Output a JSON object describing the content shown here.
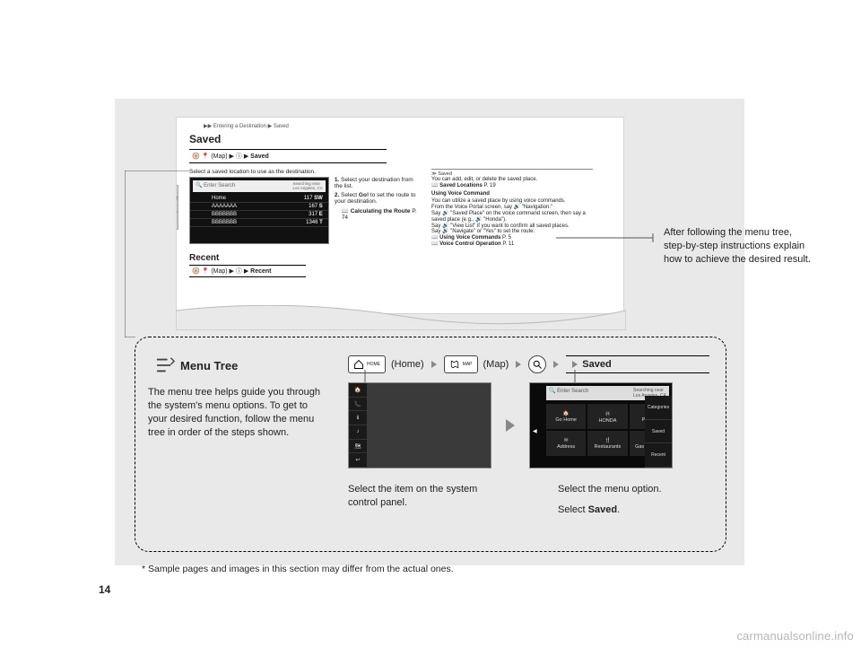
{
  "page_number": "14",
  "watermark": "carmanualsonline.info",
  "callout_text": "After following the menu tree, step-by-step instructions explain how to achieve the desired result.",
  "sample": {
    "breadcrumb_top": "▶▶ Entering a Destination ▶ Saved",
    "heading": "Saved",
    "breadcrumb2_prefix": "(Map) ▶ ⓘ ▶ ",
    "breadcrumb2_bold": "Saved",
    "instruction": "Select a saved location to use as the destination.",
    "search_placeholder": "Enter Search",
    "search_hint": "Searching near\nLos Angeles, CA",
    "rows": [
      {
        "name": "Home",
        "dist": "117",
        "dir": "SW"
      },
      {
        "name": "AAAAAAA",
        "dist": "167",
        "dir": "S"
      },
      {
        "name": "BBBBBBB",
        "dist": "317",
        "dir": "E"
      },
      {
        "name": "BBBBBBB",
        "dist": "1346",
        "dir": "T"
      }
    ],
    "step1_a": "1. ",
    "step1_b": "Select your destination from the list.",
    "step2_a": "2. ",
    "step2_b": "Select ",
    "step2_c": "Go!",
    "step2_d": " to set the route to your destination.",
    "step2_ref_label": "Calculating the Route",
    "step2_ref_page": " P. 74",
    "recent_heading": "Recent",
    "breadcrumb3_prefix": "(Map) ▶ ⓘ ▶ ",
    "breadcrumb3_bold": "Recent",
    "info": {
      "h1": "Saved",
      "l1": "You can add, edit, or delete the saved place.",
      "l1_ref": "Saved Locations",
      "l1_pg": " P. 19",
      "h2": "Using Voice Command",
      "l2a": "You can utilize a saved place by using voice commands.",
      "l2b": "From the Voice Portal screen, say 🔊 \"Navigation.\"",
      "l2c": "Say 🔊 \"Saved Place\" on the voice command screen, then say a saved place (e.g., 🔊 \"Honda\").",
      "l2d": "Say 🔊 \"View List\" if you want to confirm all saved places.",
      "l2e": "Say 🔊 \"Navigate\" or \"Yes\" to set the route.",
      "ref2": "Using Voice Commands",
      "ref2pg": " P. 5",
      "ref3": "Voice Control Operation",
      "ref3pg": " P. 11"
    }
  },
  "menu_tree": {
    "title": "Menu Tree",
    "paragraph": "The menu tree helps guide you through the system's menu options. To get to your desired function, follow the menu tree in order of the steps shown.",
    "home_label": "(Home)",
    "map_label": "(Map)",
    "saved_label": "Saved",
    "caption_panel": "Select the item on the system control panel.",
    "caption_menu_a": "Select the menu option.",
    "caption_menu_b": "Select ",
    "caption_menu_c": "Saved",
    "caption_menu_d": "."
  },
  "screenshot_b": {
    "search_placeholder": "Enter Search",
    "search_hint": "Searching near\nLos Angeles, CA",
    "tiles": [
      "Go Home",
      "HONDA",
      "Places",
      "Address",
      "Restaurants",
      "Gas Stations"
    ],
    "side": [
      "Categories",
      "Saved",
      "Recent"
    ]
  },
  "footnote": "* Sample pages and images in this section may differ from the actual ones."
}
